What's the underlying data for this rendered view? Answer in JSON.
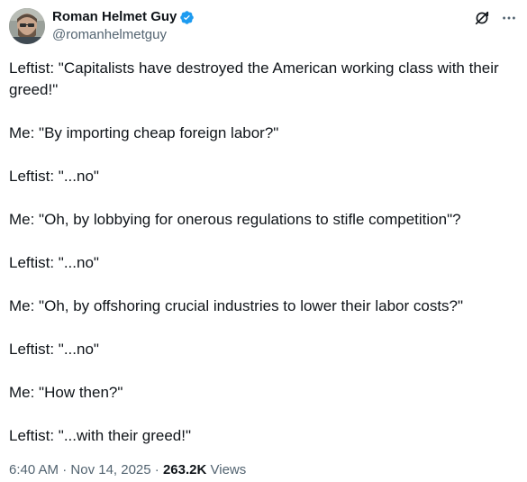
{
  "author": {
    "display_name": "Roman Helmet Guy",
    "handle": "@romanhelmetguy",
    "verified": true,
    "verified_color": "#1d9bf0"
  },
  "icons": {
    "verified": "verified-badge-icon",
    "grok": "grok-icon",
    "more": "more-icon"
  },
  "tweet": {
    "lines": [
      "Leftist: \"Capitalists have destroyed the American working class with their greed!\"",
      "Me: \"By importing cheap foreign labor?\"",
      "Leftist: \"...no\"",
      "Me: \"Oh, by lobbying for onerous regulations to stifle competition\"?",
      "Leftist: \"...no\"",
      "Me: \"Oh, by offshoring crucial industries to lower their labor costs?\"",
      "Leftist: \"...no\"",
      "Me: \"How then?\"",
      "Leftist: \"...with their greed!\""
    ]
  },
  "meta": {
    "time": "6:40 AM",
    "separator1": " · ",
    "date": "Nov 14, 2025",
    "separator2": " · ",
    "views_count": "263.2K",
    "views_label": " Views"
  },
  "colors": {
    "text_primary": "#0f1419",
    "text_secondary": "#536471",
    "background": "#ffffff"
  }
}
